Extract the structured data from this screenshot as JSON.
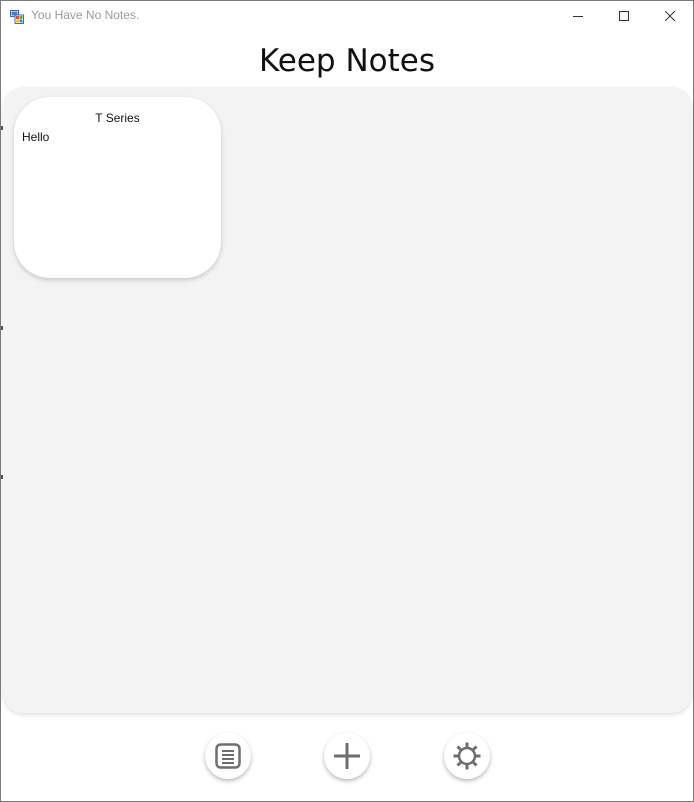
{
  "window": {
    "title": "You Have No Notes.",
    "icon": "app-window-icon",
    "controls": [
      "minimize-icon",
      "maximize-icon",
      "close-icon"
    ]
  },
  "header": {
    "title": "Keep Notes"
  },
  "notes": [
    {
      "title": "T Series",
      "body": "Hello"
    }
  ],
  "toolbar": {
    "buttons": [
      {
        "name": "notes-list-button",
        "icon": "notes-list-icon"
      },
      {
        "name": "add-note-button",
        "icon": "plus-icon"
      },
      {
        "name": "settings-button",
        "icon": "gear-icon"
      }
    ]
  },
  "colors": {
    "background": "#ffffff",
    "notes_area": "#f3f3f3",
    "card": "#ffffff",
    "icon_gray": "#6e6e6e",
    "title_text": "#111111",
    "window_title_text": "#9a9a9a"
  }
}
